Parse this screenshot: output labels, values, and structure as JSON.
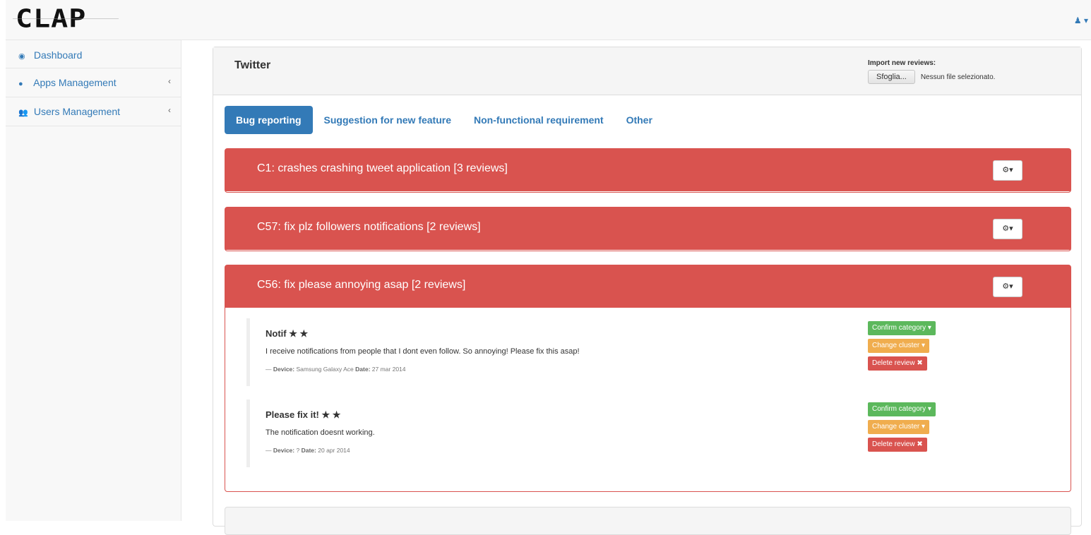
{
  "brand": {
    "logo_text": "CLAP"
  },
  "user_menu": {
    "icon": "user-icon",
    "caret": "▾"
  },
  "sidebar": {
    "items": [
      {
        "label": "Dashboard",
        "icon": "dashboard-icon",
        "glyph": "◉",
        "has_chevron": false
      },
      {
        "label": "Apps Management",
        "icon": "android-icon",
        "glyph": "●",
        "has_chevron": true
      },
      {
        "label": "Users Management",
        "icon": "users-icon",
        "glyph": "👥",
        "has_chevron": true
      }
    ],
    "chevron": "‹"
  },
  "panel": {
    "title": "Twitter",
    "import_label": "Import new reviews:",
    "file_button": "Sfoglia...",
    "file_status": "Nessun file selezionato."
  },
  "tabs": [
    {
      "label": "Bug reporting",
      "active": true
    },
    {
      "label": "Suggestion for new feature",
      "active": false
    },
    {
      "label": "Non-functional requirement",
      "active": false
    },
    {
      "label": "Other",
      "active": false
    }
  ],
  "clusters": [
    {
      "title": "C1: crashes crashing tweet application [3 reviews]",
      "expanded": false
    },
    {
      "title": "C57: fix plz followers notifications [2 reviews]",
      "expanded": false
    },
    {
      "title": "C56: fix please annoying asap [2 reviews]",
      "expanded": true,
      "reviews": [
        {
          "title": "Notif",
          "stars": "★ ★",
          "text": "I receive notifications from people that I dont even follow. So annoying! Please fix this asap!",
          "device_label": "Device:",
          "device": "Samsung Galaxy Ace",
          "date_label": "Date:",
          "date": "27 mar 2014"
        },
        {
          "title": "Please fix it!",
          "stars": "★ ★",
          "text": "The notification doesnt working.",
          "device_label": "Device:",
          "device": "?",
          "date_label": "Date:",
          "date": "20 apr 2014"
        }
      ]
    }
  ],
  "review_actions": {
    "confirm": "Confirm category",
    "change": "Change cluster",
    "delete": "Delete review",
    "caret": "▾",
    "delete_icon": "✖"
  },
  "gear_button": {
    "icon": "gear-icon",
    "glyph": "⚙▾"
  },
  "colors": {
    "primary": "#337ab7",
    "danger": "#d9534f",
    "success": "#5cb85c",
    "warning": "#f0ad4e"
  }
}
